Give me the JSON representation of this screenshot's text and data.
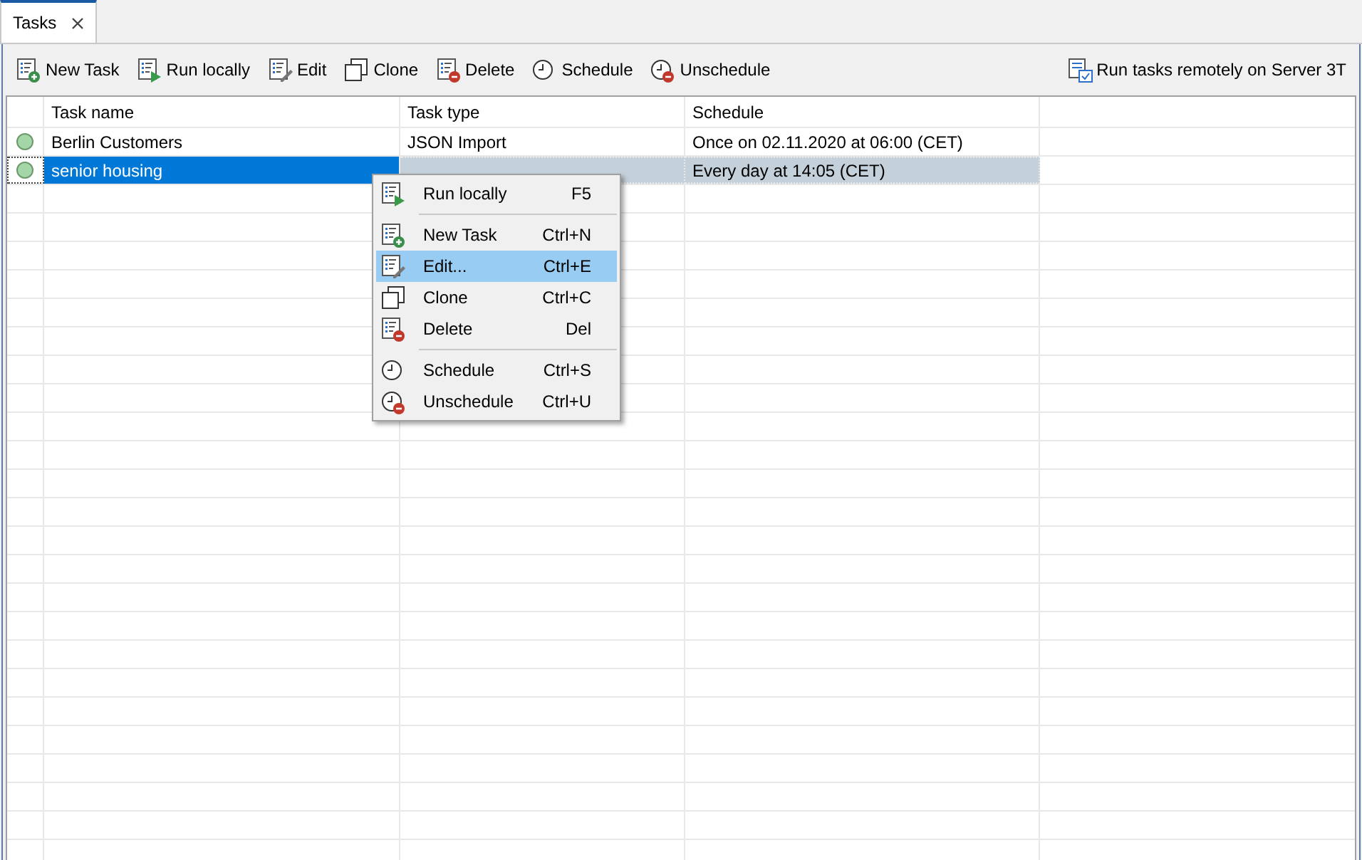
{
  "tabs": [
    {
      "label": "Tasks",
      "selected": true
    }
  ],
  "toolbar": {
    "left": [
      {
        "label": "New Task",
        "kind": "new"
      },
      {
        "label": "Run locally",
        "kind": "run"
      },
      {
        "label": "Edit",
        "kind": "edit"
      },
      {
        "label": "Clone",
        "kind": "clone"
      },
      {
        "label": "Delete",
        "kind": "delete"
      },
      {
        "label": "Schedule",
        "kind": "schedule"
      },
      {
        "label": "Unschedule",
        "kind": "unschedule"
      }
    ],
    "right": [
      {
        "label": "Run tasks remotely on Server 3T",
        "kind": "remote"
      }
    ]
  },
  "table": {
    "columns": [
      "Task name",
      "Task type",
      "Schedule"
    ],
    "rows": [
      {
        "task_name": "Berlin Customers",
        "task_type": "JSON Import",
        "schedule": "Once on 02.11.2020 at 06:00 (CET)",
        "selected": false
      },
      {
        "task_name": "senior housing",
        "schedule": "Every day at 14:05 (CET)",
        "selected": true
      }
    ]
  },
  "context_menu": {
    "items": [
      {
        "kind": "run",
        "label": "Run locally",
        "shortcut": "F5",
        "selected": false
      },
      {
        "kind": "separator"
      },
      {
        "kind": "new",
        "label": "New Task",
        "shortcut": "Ctrl+N",
        "selected": false
      },
      {
        "kind": "edit",
        "label": "Edit...",
        "shortcut": "Ctrl+E",
        "selected": true
      },
      {
        "kind": "clone",
        "label": "Clone",
        "shortcut": "Ctrl+C",
        "selected": false
      },
      {
        "kind": "delete",
        "label": "Delete",
        "shortcut": "Del",
        "selected": false
      },
      {
        "kind": "separator"
      },
      {
        "kind": "schedule",
        "label": "Schedule",
        "shortcut": "Ctrl+S",
        "selected": false
      },
      {
        "kind": "unschedule",
        "label": "Unschedule",
        "shortcut": "Ctrl+U",
        "selected": false
      }
    ]
  }
}
